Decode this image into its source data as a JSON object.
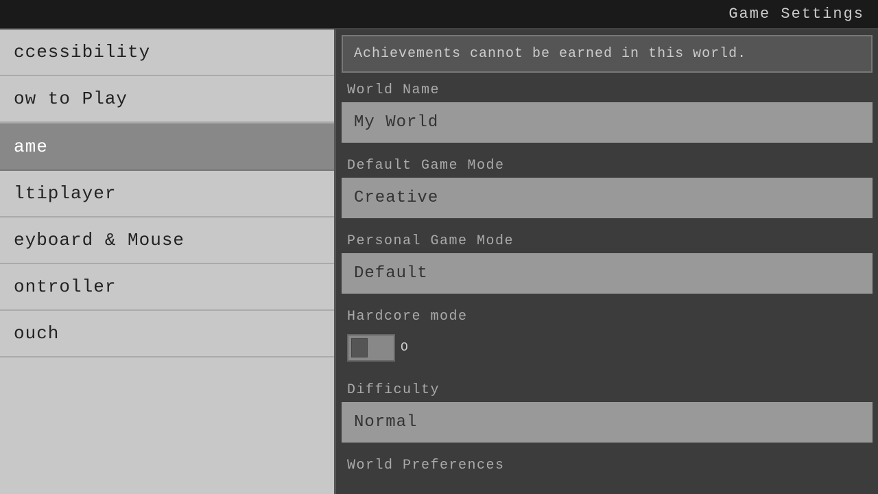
{
  "titleBar": {
    "label": "Game Settings"
  },
  "sidebar": {
    "items": [
      {
        "id": "accessibility",
        "label": "ccessibility",
        "active": false
      },
      {
        "id": "how-to-play",
        "label": "ow to Play",
        "active": false
      },
      {
        "id": "game",
        "label": "ame",
        "active": true
      },
      {
        "id": "multiplayer",
        "label": "ltiplayer",
        "active": false
      },
      {
        "id": "keyboard-mouse",
        "label": "eyboard & Mouse",
        "active": false
      },
      {
        "id": "controller",
        "label": "ontroller",
        "active": false
      },
      {
        "id": "touch",
        "label": "ouch",
        "active": false
      }
    ]
  },
  "content": {
    "achievementsBanner": "Achievements cannot be earned in this world.",
    "worldName": {
      "label": "World Name",
      "value": "My World"
    },
    "defaultGameMode": {
      "label": "Default Game Mode",
      "value": "Creative"
    },
    "personalGameMode": {
      "label": "Personal Game Mode",
      "value": "Default"
    },
    "hardcoreMode": {
      "label": "Hardcore mode",
      "toggleText": "O",
      "enabled": false
    },
    "difficulty": {
      "label": "Difficulty",
      "value": "Normal"
    },
    "worldPreferences": {
      "label": "World Preferences"
    }
  }
}
